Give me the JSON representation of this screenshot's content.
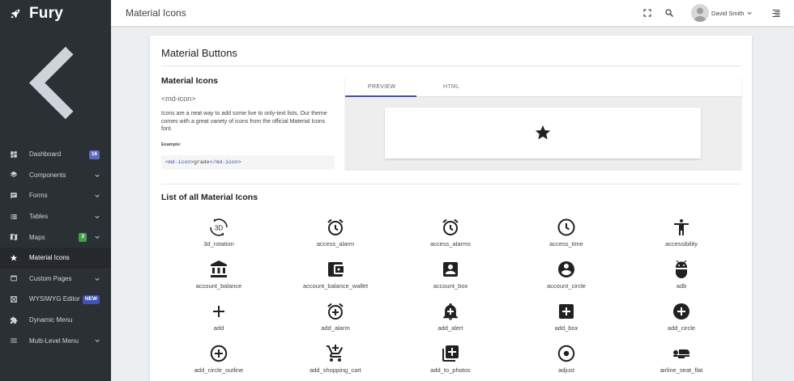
{
  "brand": {
    "name": "Fury",
    "logo_icon": "rocket-icon"
  },
  "sidebar": {
    "items": [
      {
        "label": "Dashboard",
        "icon": "dashboard-icon",
        "badge": "16"
      },
      {
        "label": "Components",
        "icon": "layers-icon"
      },
      {
        "label": "Forms",
        "icon": "forms-icon"
      },
      {
        "label": "Tables",
        "icon": "list-icon"
      },
      {
        "label": "Maps",
        "icon": "map-icon",
        "badge": "3"
      },
      {
        "label": "Material Icons",
        "icon": "star-icon"
      },
      {
        "label": "Custom Pages",
        "icon": "pages-icon"
      },
      {
        "label": "WYSIWYG Editor",
        "icon": "editor-icon",
        "badge": "NEW"
      },
      {
        "label": "Dynamic Menu",
        "icon": "puzzle-icon"
      },
      {
        "label": "Multi-Level Menu",
        "icon": "menu-icon"
      }
    ]
  },
  "header": {
    "title": "Material Icons",
    "user_name": "David Smith"
  },
  "card": {
    "title": "Material Buttons",
    "section_title": "Material Icons",
    "tag": "<md-icon>",
    "description": "Icons are a neat way to add some live to only-text lists. Our theme comes with a great variety of icons from the official Material Icons font.",
    "example_label": "Example:",
    "code_open": "<md-icon>",
    "code_text": "grade",
    "code_close": "</md-icon>",
    "tabs": [
      "PREVIEW",
      "HTML"
    ],
    "list_title": "List of all Material Icons"
  },
  "icons": [
    "3d_rotation",
    "access_alarm",
    "access_alarms",
    "access_time",
    "accessibility",
    "account_balance",
    "account_balance_wallet",
    "account_box",
    "account_circle",
    "adb",
    "add",
    "add_alarm",
    "add_alert",
    "add_box",
    "add_circle",
    "add_circle_outline",
    "add_shopping_cart",
    "add_to_photos",
    "adjust",
    "airline_seat_flat"
  ],
  "colors": {
    "sidebar": "#2b3035",
    "accent": "#3f51b5",
    "badge_blue": "#5c6bc0",
    "badge_green": "#43a047"
  }
}
